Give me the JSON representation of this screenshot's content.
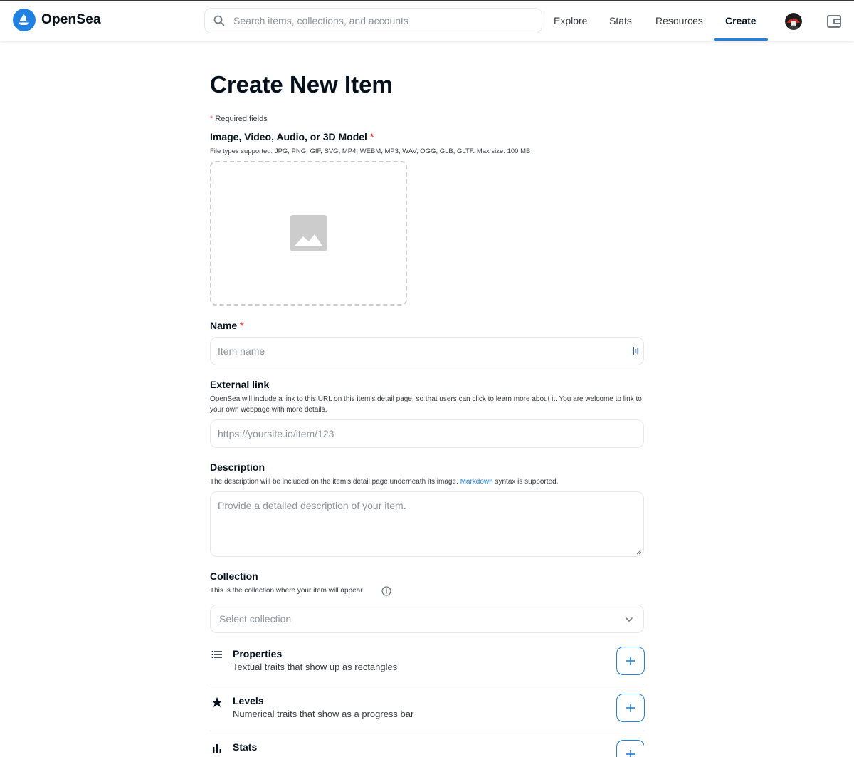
{
  "app": {
    "name": "OpenSea"
  },
  "header": {
    "search_placeholder": "Search items, collections, and accounts",
    "nav": [
      {
        "label": "Explore"
      },
      {
        "label": "Stats"
      },
      {
        "label": "Resources"
      },
      {
        "label": "Create",
        "active": true
      }
    ],
    "icons": {
      "logo": "opensea-boat-icon",
      "search": "search-icon",
      "avatar": "user-avatar",
      "wallet": "wallet-icon"
    }
  },
  "page": {
    "title": "Create New Item",
    "required_star": "*",
    "required_note": "Required fields"
  },
  "media": {
    "label": "Image, Video, Audio, or 3D Model",
    "required_star": "*",
    "caption": "File types supported: JPG, PNG, GIF, SVG, MP4, WEBM, MP3, WAV, OGG, GLB, GLTF. Max size: 100 MB",
    "icon": "image-placeholder-icon"
  },
  "name_field": {
    "label": "Name",
    "required_star": "*",
    "placeholder": "Item name",
    "value": ""
  },
  "external_link": {
    "label": "External link",
    "caption": "OpenSea will include a link to this URL on this item's detail page, so that users can click to learn more about it. You are welcome to link to your own webpage with more details.",
    "placeholder": "https://yoursite.io/item/123",
    "value": ""
  },
  "description": {
    "label": "Description",
    "caption_before": "The description will be included on the item's detail page underneath its image.",
    "caption_link": "Markdown",
    "caption_after": "syntax is supported.",
    "placeholder": "Provide a detailed description of your item.",
    "value": ""
  },
  "collection": {
    "label": "Collection",
    "caption": "This is the collection where your item will appear.",
    "select_placeholder": "Select collection"
  },
  "traits": [
    {
      "title": "Properties",
      "subtitle": "Textual traits that show up as rectangles",
      "icon": "list-icon"
    },
    {
      "title": "Levels",
      "subtitle": "Numerical traits that show as a progress bar",
      "icon": "star-icon"
    },
    {
      "title": "Stats",
      "subtitle": "",
      "icon": "bar-chart-icon"
    }
  ],
  "colors": {
    "accent": "#2081e2",
    "required": "#eb5757",
    "text": "#04111d",
    "muted": "#8a939b",
    "border": "#e5e8eb"
  }
}
